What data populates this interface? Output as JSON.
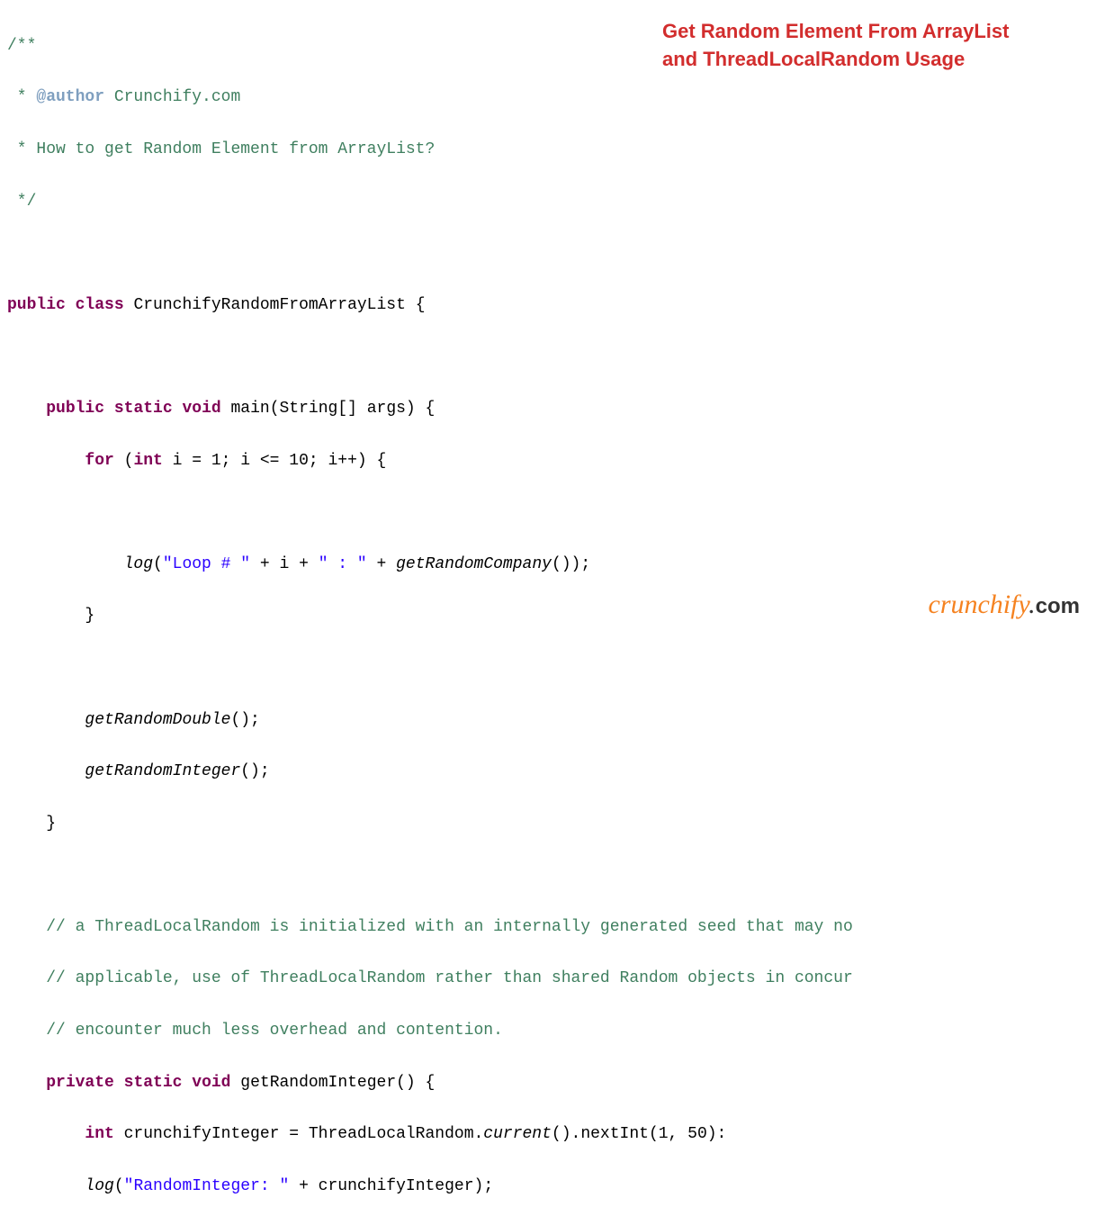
{
  "headline": {
    "line1": "Get Random Element From ArrayList",
    "line2": "and ThreadLocalRandom Usage"
  },
  "code": {
    "l1_open": "/**",
    "l2_prefix": " * ",
    "l2_tag": "@author",
    "l2_rest": " Crunchify.com",
    "l3": " * How to get Random Element from ArrayList?",
    "l4": " */",
    "l6_kw1": "public",
    "l6_kw2": "class",
    "l6_name": " CrunchifyRandomFromArrayList {",
    "l8_indent": "    ",
    "l8_kw1": "public",
    "l8_kw2": "static",
    "l8_kw3": "void",
    "l8_rest": " main(String[] args) {",
    "l9_indent": "        ",
    "l9_kw": "for",
    "l9_paren": " (",
    "l9_kw2": "int",
    "l9_rest": " i = 1; i <= 10; i++) {",
    "l11_indent": "            ",
    "l11_method": "log",
    "l11_p1": "(",
    "l11_str1": "\"Loop # \"",
    "l11_mid1": " + i + ",
    "l11_str2": "\" : \"",
    "l11_mid2": " + ",
    "l11_method2": "getRandomCompany",
    "l11_end": "());",
    "l12": "        }",
    "l14_indent": "        ",
    "l14_m1": "getRandomDouble",
    "l14_end": "();",
    "l15_indent": "        ",
    "l15_m1": "getRandomInteger",
    "l15_end": "();",
    "l16": "    }",
    "l18": "    // a ThreadLocalRandom is initialized with an internally generated seed that may no",
    "l19": "    // applicable, use of ThreadLocalRandom rather than shared Random objects in concur",
    "l20": "    // encounter much less overhead and contention.",
    "l21_indent": "    ",
    "l21_kw1": "private",
    "l21_kw2": "static",
    "l21_kw3": "void",
    "l21_rest": " getRandomInteger() {",
    "l22_indent": "        ",
    "l22_kw": "int",
    "l22_mid": " crunchifyInteger = ThreadLocalRandom.",
    "l22_method": "current",
    "l22_end": "().nextInt(1, 50):",
    "l23_indent": "        ",
    "l23_method": "log",
    "l23_p1": "(",
    "l23_str": "\"RandomInteger: \"",
    "l23_end": " + crunchifyInteger);"
  },
  "watermark": {
    "brand": "crunchify",
    "dot": ".",
    "com": "com"
  }
}
